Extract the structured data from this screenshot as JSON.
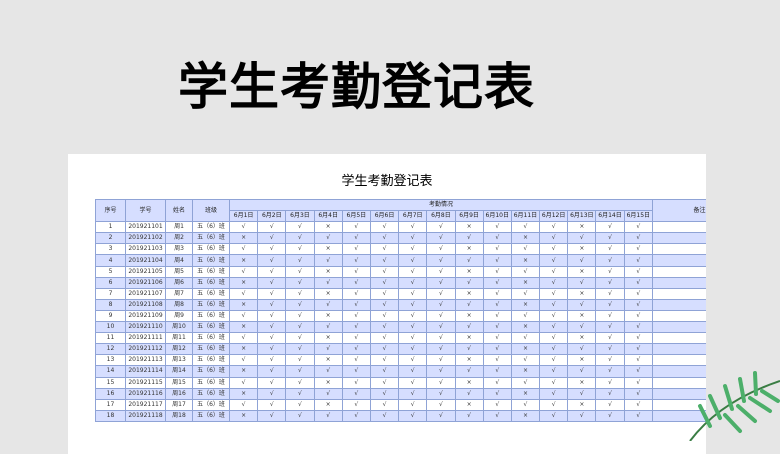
{
  "page_title": "学生考勤登记表",
  "sheet_title": "学生考勤登记表",
  "headers": {
    "seq": "序号",
    "id": "学号",
    "name": "姓名",
    "class": "班级",
    "attendance": "考勤情况",
    "note": "备注",
    "dates": [
      "6月1日",
      "6月2日",
      "6月3日",
      "6月4日",
      "6月5日",
      "6月6日",
      "6月7日",
      "6月8日",
      "6月9日",
      "6月10日",
      "6月11日",
      "6月12日",
      "6月13日",
      "6月14日",
      "6月15日"
    ]
  },
  "rows": [
    {
      "seq": "1",
      "id": "201921101",
      "name": "周1",
      "class": "五（6）班",
      "marks": [
        "√",
        "√",
        "√",
        "×",
        "√",
        "√",
        "√",
        "√",
        "×",
        "√",
        "√",
        "√",
        "×",
        "√",
        "√"
      ]
    },
    {
      "seq": "2",
      "id": "201921102",
      "name": "周2",
      "class": "五（6）班",
      "marks": [
        "×",
        "√",
        "√",
        "√",
        "√",
        "√",
        "√",
        "√",
        "√",
        "√",
        "×",
        "√",
        "√",
        "√",
        "√"
      ]
    },
    {
      "seq": "3",
      "id": "201921103",
      "name": "周3",
      "class": "五（6）班",
      "marks": [
        "√",
        "√",
        "√",
        "×",
        "√",
        "√",
        "√",
        "√",
        "×",
        "√",
        "√",
        "√",
        "×",
        "√",
        "√"
      ]
    },
    {
      "seq": "4",
      "id": "201921104",
      "name": "周4",
      "class": "五（6）班",
      "marks": [
        "×",
        "√",
        "√",
        "√",
        "√",
        "√",
        "√",
        "√",
        "√",
        "√",
        "×",
        "√",
        "√",
        "√",
        "√"
      ]
    },
    {
      "seq": "5",
      "id": "201921105",
      "name": "周5",
      "class": "五（6）班",
      "marks": [
        "√",
        "√",
        "√",
        "×",
        "√",
        "√",
        "√",
        "√",
        "×",
        "√",
        "√",
        "√",
        "×",
        "√",
        "√"
      ]
    },
    {
      "seq": "6",
      "id": "201921106",
      "name": "周6",
      "class": "五（6）班",
      "marks": [
        "×",
        "√",
        "√",
        "√",
        "√",
        "√",
        "√",
        "√",
        "√",
        "√",
        "×",
        "√",
        "√",
        "√",
        "√"
      ]
    },
    {
      "seq": "7",
      "id": "201921107",
      "name": "周7",
      "class": "五（6）班",
      "marks": [
        "√",
        "√",
        "√",
        "×",
        "√",
        "√",
        "√",
        "√",
        "×",
        "√",
        "√",
        "√",
        "×",
        "√",
        "√"
      ]
    },
    {
      "seq": "8",
      "id": "201921108",
      "name": "周8",
      "class": "五（6）班",
      "marks": [
        "×",
        "√",
        "√",
        "√",
        "√",
        "√",
        "√",
        "√",
        "√",
        "√",
        "×",
        "√",
        "√",
        "√",
        "√"
      ]
    },
    {
      "seq": "9",
      "id": "201921109",
      "name": "周9",
      "class": "五（6）班",
      "marks": [
        "√",
        "√",
        "√",
        "×",
        "√",
        "√",
        "√",
        "√",
        "×",
        "√",
        "√",
        "√",
        "×",
        "√",
        "√"
      ]
    },
    {
      "seq": "10",
      "id": "201921110",
      "name": "周10",
      "class": "五（6）班",
      "marks": [
        "×",
        "√",
        "√",
        "√",
        "√",
        "√",
        "√",
        "√",
        "√",
        "√",
        "×",
        "√",
        "√",
        "√",
        "√"
      ]
    },
    {
      "seq": "11",
      "id": "201921111",
      "name": "周11",
      "class": "五（6）班",
      "marks": [
        "√",
        "√",
        "√",
        "×",
        "√",
        "√",
        "√",
        "√",
        "×",
        "√",
        "√",
        "√",
        "×",
        "√",
        "√"
      ]
    },
    {
      "seq": "12",
      "id": "201921112",
      "name": "周12",
      "class": "五（6）班",
      "marks": [
        "×",
        "√",
        "√",
        "√",
        "√",
        "√",
        "√",
        "√",
        "√",
        "√",
        "×",
        "√",
        "√",
        "√",
        "√"
      ]
    },
    {
      "seq": "13",
      "id": "201921113",
      "name": "周13",
      "class": "五（6）班",
      "marks": [
        "√",
        "√",
        "√",
        "×",
        "√",
        "√",
        "√",
        "√",
        "×",
        "√",
        "√",
        "√",
        "×",
        "√",
        "√"
      ]
    },
    {
      "seq": "14",
      "id": "201921114",
      "name": "周14",
      "class": "五（6）班",
      "marks": [
        "×",
        "√",
        "√",
        "√",
        "√",
        "√",
        "√",
        "√",
        "√",
        "√",
        "×",
        "√",
        "√",
        "√",
        "√"
      ]
    },
    {
      "seq": "15",
      "id": "201921115",
      "name": "周15",
      "class": "五（6）班",
      "marks": [
        "√",
        "√",
        "√",
        "×",
        "√",
        "√",
        "√",
        "√",
        "×",
        "√",
        "√",
        "√",
        "×",
        "√",
        "√"
      ]
    },
    {
      "seq": "16",
      "id": "201921116",
      "name": "周16",
      "class": "五（6）班",
      "marks": [
        "×",
        "√",
        "√",
        "√",
        "√",
        "√",
        "√",
        "√",
        "√",
        "√",
        "×",
        "√",
        "√",
        "√",
        "√"
      ]
    },
    {
      "seq": "17",
      "id": "201921117",
      "name": "周17",
      "class": "五（6）班",
      "marks": [
        "√",
        "√",
        "√",
        "×",
        "√",
        "√",
        "√",
        "√",
        "×",
        "√",
        "√",
        "√",
        "×",
        "√",
        "√"
      ]
    },
    {
      "seq": "18",
      "id": "201921118",
      "name": "周18",
      "class": "五（6）班",
      "marks": [
        "×",
        "√",
        "√",
        "√",
        "√",
        "√",
        "√",
        "√",
        "√",
        "√",
        "×",
        "√",
        "√",
        "√",
        "√"
      ]
    }
  ],
  "decor": {
    "leaf_icon": "palm-leaf-icon",
    "leaf_color": "#2e8b57"
  }
}
